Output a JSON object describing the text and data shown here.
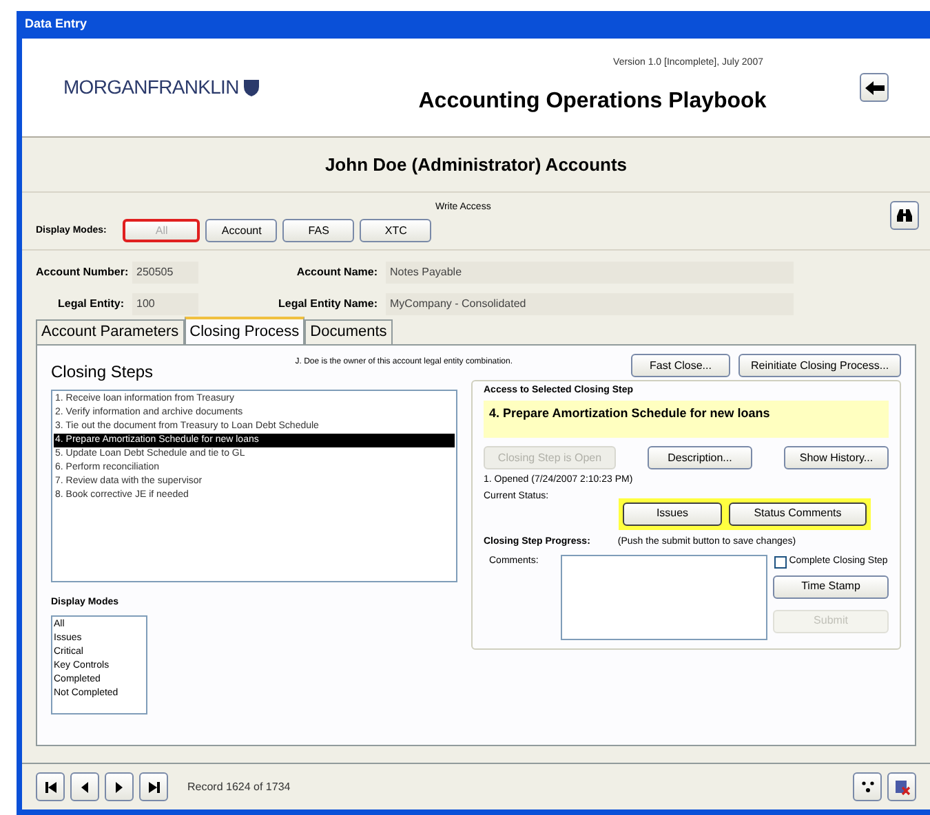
{
  "window": {
    "title": "Data Entry"
  },
  "header": {
    "logo": "MORGANFRANKLIN",
    "version": "Version 1.0 [Incomplete], July 2007",
    "title": "Accounting Operations Playbook"
  },
  "user_heading": "John Doe (Administrator) Accounts",
  "access": "Write Access",
  "display_modes_bar": {
    "label": "Display Modes:",
    "buttons": [
      {
        "label": "All",
        "selected": true
      },
      {
        "label": "Account",
        "selected": false
      },
      {
        "label": "FAS",
        "selected": false
      },
      {
        "label": "XTC",
        "selected": false
      }
    ]
  },
  "account": {
    "fields": [
      {
        "label": "Account Number:",
        "value": "250505"
      },
      {
        "label": "Account Name:",
        "value": "Notes Payable"
      },
      {
        "label": "Legal Entity:",
        "value": "100"
      },
      {
        "label": "Legal Entity Name:",
        "value": "MyCompany - Consolidated"
      }
    ]
  },
  "tabs": [
    {
      "label": "Account Parameters",
      "selected": false
    },
    {
      "label": "Closing Process",
      "selected": true
    },
    {
      "label": "Documents",
      "selected": false
    }
  ],
  "closing_steps": {
    "heading": "Closing Steps",
    "owner_note": "J. Doe is the owner of this account legal entity combination.",
    "steps": [
      {
        "label": "1. Receive loan information from Treasury",
        "selected": false
      },
      {
        "label": "2. Verify information and archive documents",
        "selected": false
      },
      {
        "label": "3. Tie out the document from Treasury to Loan Debt Schedule",
        "selected": false
      },
      {
        "label": "4. Prepare Amortization Schedule for new loans",
        "selected": true
      },
      {
        "label": "5. Update Loan Debt Schedule and tie to GL",
        "selected": false
      },
      {
        "label": "6. Perform reconciliation",
        "selected": false
      },
      {
        "label": "7. Review data with the supervisor",
        "selected": false
      },
      {
        "label": "8. Book corrective JE if needed",
        "selected": false
      }
    ]
  },
  "display_modes_list": {
    "label": "Display Modes",
    "items": [
      "All",
      "Issues",
      "Critical",
      "Key Controls",
      "Completed",
      "Not Completed"
    ]
  },
  "process_buttons": [
    "Fast Close...",
    "Reinitiate Closing Process..."
  ],
  "selected_step": {
    "legend": "Access to Selected Closing Step",
    "title": "4. Prepare Amortization Schedule for new loans",
    "buttons": [
      {
        "label": "Closing Step is Open",
        "disabled": true
      },
      {
        "label": "Description...",
        "disabled": false
      },
      {
        "label": "Show History...",
        "disabled": false
      }
    ],
    "opened": "1. Opened (7/24/2007 2:10:23 PM)",
    "status_label": "Current Status:",
    "status_buttons": [
      "Issues",
      "Status Comments"
    ],
    "progress_label": "Closing Step Progress:",
    "progress_hint": "(Push the submit button to save changes)",
    "comments_label": "Comments:",
    "complete": {
      "label": "Complete Closing Step",
      "checked": false
    },
    "time_stamp": "Time Stamp",
    "submit": {
      "label": "Submit",
      "disabled": true
    }
  },
  "status_bar": {
    "record": "Record 1624 of 1734"
  }
}
